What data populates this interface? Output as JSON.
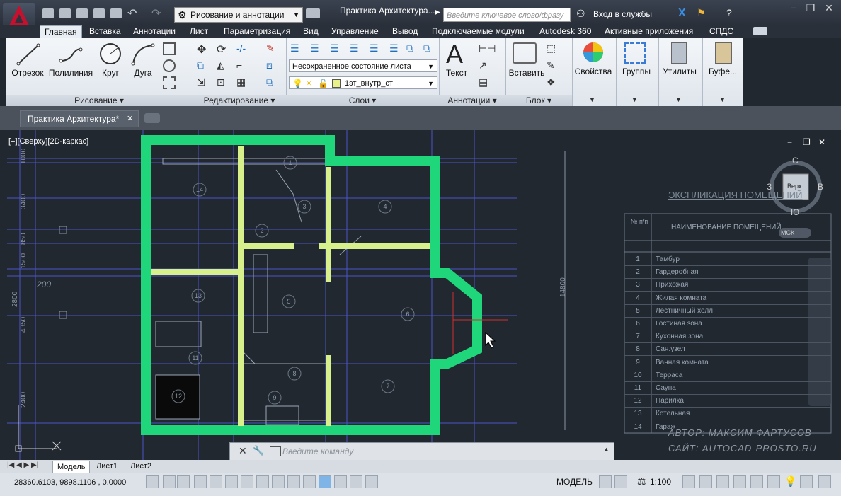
{
  "app": {
    "workspace": "Рисование и аннотации",
    "doc_title": "Практика Архитектура...",
    "search_placeholder": "Введите ключевое слово/фразу",
    "sign_in": "Вход в службы"
  },
  "ribbon_tabs": [
    "Главная",
    "Вставка",
    "Аннотации",
    "Лист",
    "Параметризация",
    "Вид",
    "Управление",
    "Вывод",
    "Подключаемые модули",
    "Autodesk 360",
    "Активные приложения",
    "СПДС"
  ],
  "ribbon": {
    "draw_tools": [
      "Отрезок",
      "Полилиния",
      "Круг",
      "Дуга"
    ],
    "panel_draw": "Рисование",
    "panel_modify": "Редактирование",
    "panel_layers": "Слои",
    "panel_annotations": "Аннотации",
    "panel_block": "Блок",
    "layer_state": "Несохраненное состояние листа",
    "current_layer": "1эт_внутр_ст",
    "text_label": "Текст",
    "insert_label": "Вставить",
    "properties_label": "Свойства",
    "groups_label": "Группы",
    "utilities_label": "Утилиты",
    "buffer_label": "Буфе..."
  },
  "file_tab": "Практика Архитектура*",
  "viewport_label": "[−][Сверху][2D-каркас]",
  "viewcube": {
    "n": "С",
    "s": "Ю",
    "w": "З",
    "e": "В",
    "face": "Верх",
    "ucs": "МСК"
  },
  "drawing": {
    "room_numbers": [
      "1",
      "2",
      "3",
      "4",
      "5",
      "6",
      "7",
      "8",
      "9",
      "11",
      "12",
      "13",
      "14"
    ],
    "dims": [
      "1000",
      "3400",
      "850",
      "1500",
      "2800",
      "4350",
      "2400",
      "200",
      "14800"
    ]
  },
  "explication": {
    "title": "ЭКСПЛИКАЦИЯ ПОМЕЩЕНИЙ",
    "col_num": "№ п/п",
    "col_name": "НАИМЕНОВАНИЕ ПОМЕЩЕНИЙ",
    "rows": [
      {
        "n": "1",
        "name": "Тамбур"
      },
      {
        "n": "2",
        "name": "Гардеробная"
      },
      {
        "n": "3",
        "name": "Прихожая"
      },
      {
        "n": "4",
        "name": "Жилая комната"
      },
      {
        "n": "5",
        "name": "Лестничный холл"
      },
      {
        "n": "6",
        "name": "Гостиная  зона"
      },
      {
        "n": "7",
        "name": "Кухонная зона"
      },
      {
        "n": "8",
        "name": "Сан.узел"
      },
      {
        "n": "9",
        "name": "Ванная комната"
      },
      {
        "n": "10",
        "name": "Терраса"
      },
      {
        "n": "11",
        "name": "Сауна"
      },
      {
        "n": "12",
        "name": "Парилка"
      },
      {
        "n": "13",
        "name": "Котельная"
      },
      {
        "n": "14",
        "name": "Гараж"
      }
    ]
  },
  "watermark": {
    "author": "АВТОР: МАКСИМ ФАРТУСОВ",
    "site": "САЙТ: AUTOCAD-PROSTO.RU"
  },
  "command_placeholder": "Введите команду",
  "layout_tabs": [
    "Модель",
    "Лист1",
    "Лист2"
  ],
  "status": {
    "coords": "28360.6103, 9898.1106 , 0.0000",
    "model": "МОДЕЛЬ",
    "scale": "1:100"
  },
  "colors": {
    "outer_wall": "#1fd67a",
    "inner_wall": "#d8f08c",
    "grid": "#4a56c8",
    "background": "#212830"
  }
}
